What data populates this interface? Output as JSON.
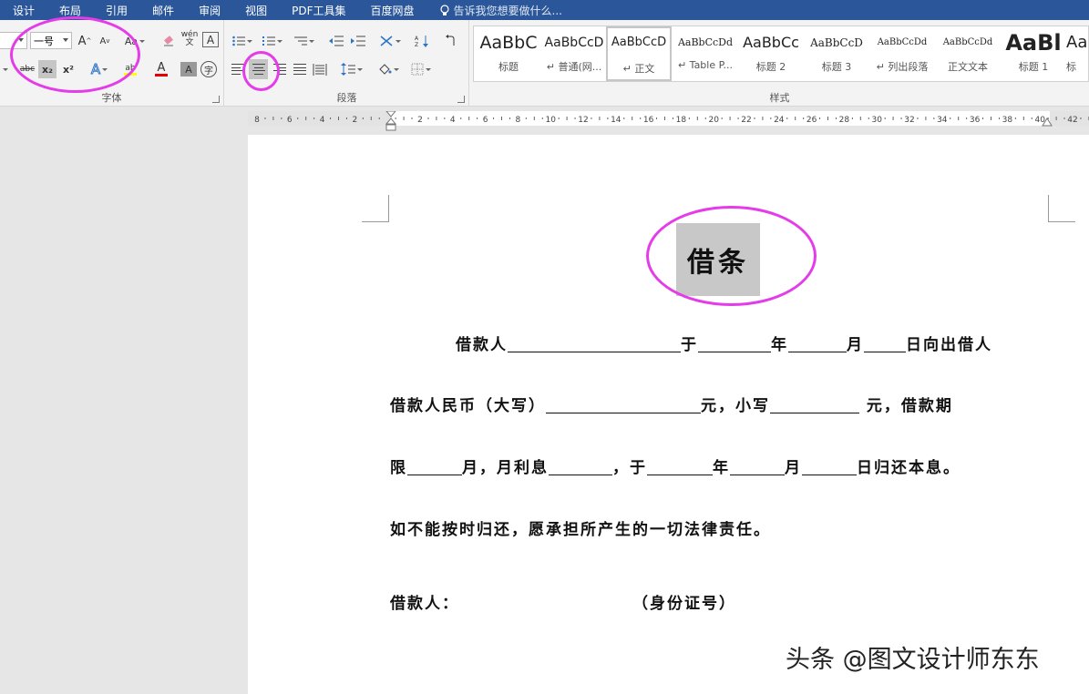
{
  "menu": {
    "tabs": [
      "设计",
      "布局",
      "引用",
      "邮件",
      "审阅",
      "视图",
      "PDF工具集",
      "百度网盘"
    ],
    "tell_me": "告诉我您想要做什么..."
  },
  "ribbon": {
    "font_group": {
      "label": "字体",
      "size_value": "一号",
      "grow_label": "A",
      "shrink_label": "A",
      "case_label": "Aa",
      "phonetic_label": "wén",
      "border_char_label": "A",
      "strike_label": "abc",
      "sub_label": "x₂",
      "sup_label": "x²",
      "effects_label": "A",
      "highlight_label": "ab",
      "font_color_label": "A",
      "shade_label": "A",
      "enclose_label": "字",
      "font_color": "#e00000",
      "highlight_color": "#ffff00"
    },
    "paragraph_group": {
      "label": "段落"
    },
    "styles_group": {
      "label": "样式",
      "items": [
        {
          "preview": "AaBbC",
          "name": "标题"
        },
        {
          "preview": "AaBbCcD",
          "name": "↵ 普通(网..."
        },
        {
          "preview": "AaBbCcD",
          "name": "↵ 正文"
        },
        {
          "preview": "AaBbCcDd",
          "name": "↵ Table P..."
        },
        {
          "preview": "AaBbCc",
          "name": "标题 2"
        },
        {
          "preview": "AaBbCcD",
          "name": "标题 3"
        },
        {
          "preview": "AaBbCcDd",
          "name": "↵ 列出段落"
        },
        {
          "preview": "AaBbCcDd",
          "name": "正文文本"
        },
        {
          "preview": "AaBl",
          "name": "标题 1"
        },
        {
          "preview": "Aa",
          "name": "标"
        }
      ]
    }
  },
  "ruler": {
    "labels": [
      "8",
      "6",
      "4",
      "2",
      "",
      "2",
      "4",
      "6",
      "8",
      "10",
      "12",
      "14",
      "16",
      "18",
      "20",
      "22",
      "24",
      "26",
      "28",
      "30",
      "32",
      "34",
      "36",
      "38",
      "40",
      "42"
    ]
  },
  "document": {
    "title": "借条",
    "line1": {
      "a": "借款人",
      "b": "于",
      "c": "年",
      "d": "月",
      "e": "日向出借人"
    },
    "line2": {
      "a": "借款人民币（大写）",
      "b": "元，小写",
      "c": " 元，借款期"
    },
    "line3": {
      "a": "限",
      "b": "月，月利息",
      "c": "，于",
      "d": "年",
      "e": "月",
      "f": "日归还本息。"
    },
    "line4": "如不能按时归还，愿承担所产生的一切法律责任。",
    "line5": {
      "a": "借款人：",
      "b": "（身份证号）"
    }
  },
  "annotation_color": "#e43ce8",
  "watermark": "头条 @图文设计师东东"
}
